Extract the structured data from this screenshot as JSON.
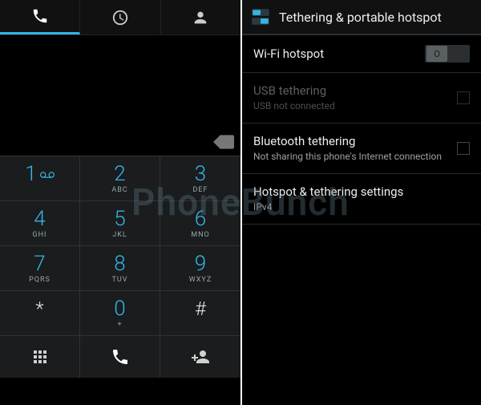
{
  "watermark": "PhoneBunch",
  "dialer": {
    "tabs": [
      {
        "name": "dialpad",
        "active": true
      },
      {
        "name": "recent",
        "active": false
      },
      {
        "name": "contacts",
        "active": false
      }
    ],
    "keys": [
      {
        "digit": "1",
        "letters": "",
        "extra": "voicemail"
      },
      {
        "digit": "2",
        "letters": "ABC"
      },
      {
        "digit": "3",
        "letters": "DEF"
      },
      {
        "digit": "4",
        "letters": "GHI"
      },
      {
        "digit": "5",
        "letters": "JKL"
      },
      {
        "digit": "6",
        "letters": "MNO"
      },
      {
        "digit": "7",
        "letters": "PQRS"
      },
      {
        "digit": "8",
        "letters": "TUV"
      },
      {
        "digit": "9",
        "letters": "WXYZ"
      },
      {
        "digit": "*",
        "letters": ""
      },
      {
        "digit": "0",
        "letters": "+"
      },
      {
        "digit": "#",
        "letters": ""
      }
    ],
    "actions": [
      "dialpad-grid",
      "call",
      "add-contact"
    ]
  },
  "settings": {
    "title": "Tethering & portable hotspot",
    "rows": {
      "wifi_hotspot": {
        "label": "Wi-Fi hotspot",
        "toggle": "off"
      },
      "usb_tether": {
        "label": "USB tethering",
        "sub": "USB not connected",
        "checked": false,
        "disabled": true
      },
      "bt_tether": {
        "label": "Bluetooth tethering",
        "sub": "Not sharing this phone's Internet connection",
        "checked": false
      },
      "hotspot_cfg": {
        "label": "Hotspot & tethering settings",
        "sub": "IPv4"
      }
    }
  }
}
